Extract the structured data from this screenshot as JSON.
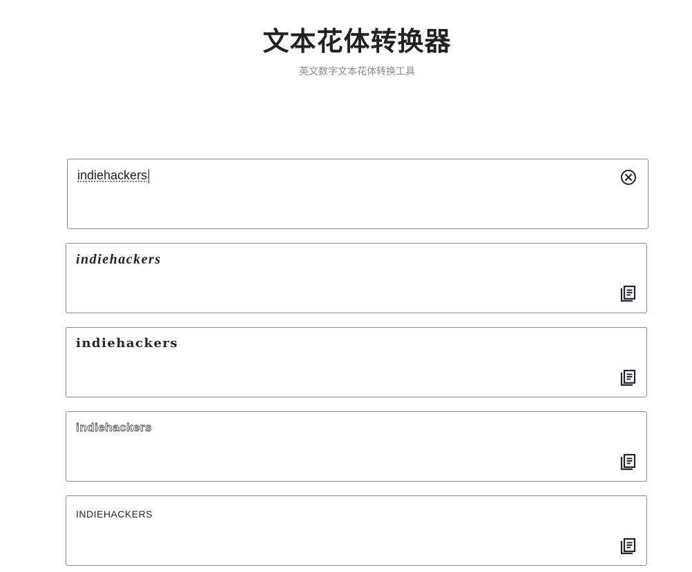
{
  "header": {
    "title": "文本花体转换器",
    "subtitle": "英文数字文本花体转换工具"
  },
  "input": {
    "value": "indiehackers",
    "clear_icon": "close-circle-icon"
  },
  "outputs": [
    {
      "text": "indiehackers",
      "style": "script",
      "copy_icon": "copy-icon"
    },
    {
      "text": "indiehackers",
      "style": "fraktur",
      "copy_icon": "copy-icon"
    },
    {
      "text": "indiehackers",
      "style": "double-struck",
      "copy_icon": "copy-icon"
    },
    {
      "text": "INDIEHACKERS",
      "style": "uppercase",
      "copy_icon": "copy-icon"
    }
  ],
  "colors": {
    "text": "#1f2430",
    "muted": "#8a8a8a",
    "border": "#8c8c8c",
    "spellcheck": "#d23a3a"
  }
}
